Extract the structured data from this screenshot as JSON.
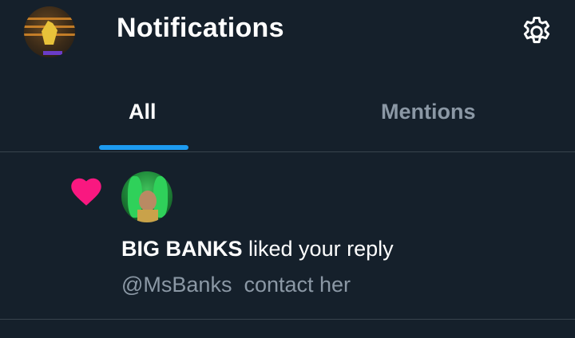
{
  "header": {
    "title": "Notifications",
    "avatar_icon": "user-avatar",
    "settings_icon": "gear-icon"
  },
  "tabs": [
    {
      "label": "All",
      "selected": true
    },
    {
      "label": "Mentions",
      "selected": false
    }
  ],
  "notification": {
    "type_icon": "heart-icon",
    "user_name": "BIG BANKS",
    "action": " liked your reply",
    "handle": "@MsBanks",
    "snippet": "contact her"
  },
  "colors": {
    "background": "#15202b",
    "accent": "#1d9bf0",
    "heart": "#f91880",
    "secondary_text": "#8b98a5",
    "divider": "#38444d"
  }
}
